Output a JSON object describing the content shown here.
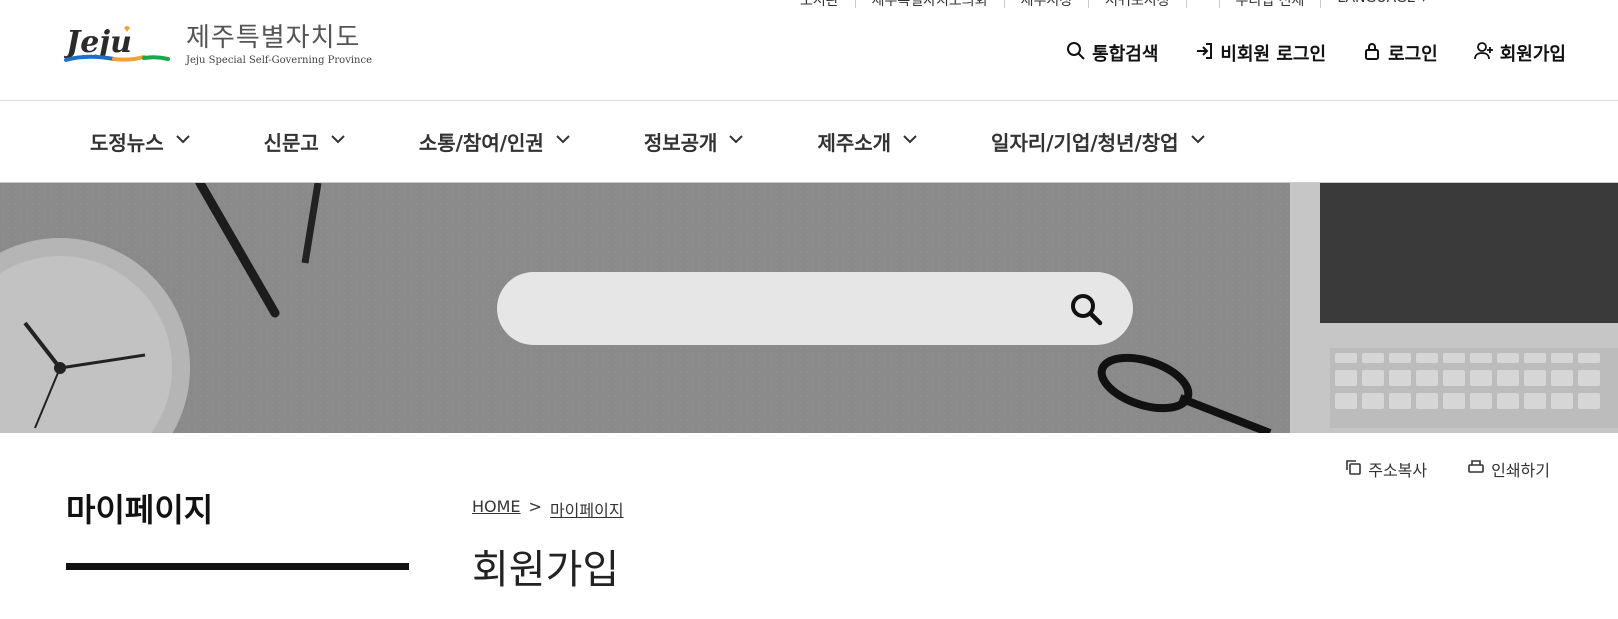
{
  "utility": {
    "items": [
      "도서관",
      "제주특별자치도의회",
      "제주시청",
      "서귀포시청",
      "",
      "누리집 전체",
      "LANGUAGE ▾"
    ]
  },
  "logo": {
    "title_kr": "제주특별자치도",
    "title_en": "Jeju Special Self-Governing Province",
    "mark_text": "Jeju"
  },
  "auth": {
    "search_label": "통합검색",
    "guest_login_label": "비회원 로그인",
    "login_label": "로그인",
    "signup_label": "회원가입"
  },
  "gnb": {
    "items": [
      {
        "label": "도정뉴스"
      },
      {
        "label": "신문고"
      },
      {
        "label": "소통/참여/인권"
      },
      {
        "label": "정보공개"
      },
      {
        "label": "제주소개"
      },
      {
        "label": "일자리/기업/청년/창업"
      }
    ]
  },
  "hero": {
    "search_placeholder": "",
    "search_value": ""
  },
  "sidebar": {
    "title": "마이페이지"
  },
  "tools": {
    "copy_url_label": "주소복사",
    "print_label": "인쇄하기"
  },
  "breadcrumb": {
    "home": "HOME",
    "separator": ">",
    "current": "마이페이지"
  },
  "page": {
    "title": "회원가입"
  },
  "colors": {
    "accent_blue": "#1e6fc7",
    "accent_green": "#1aa64a",
    "accent_orange": "#f2a233",
    "hero_bg": "#8a8a8a"
  }
}
